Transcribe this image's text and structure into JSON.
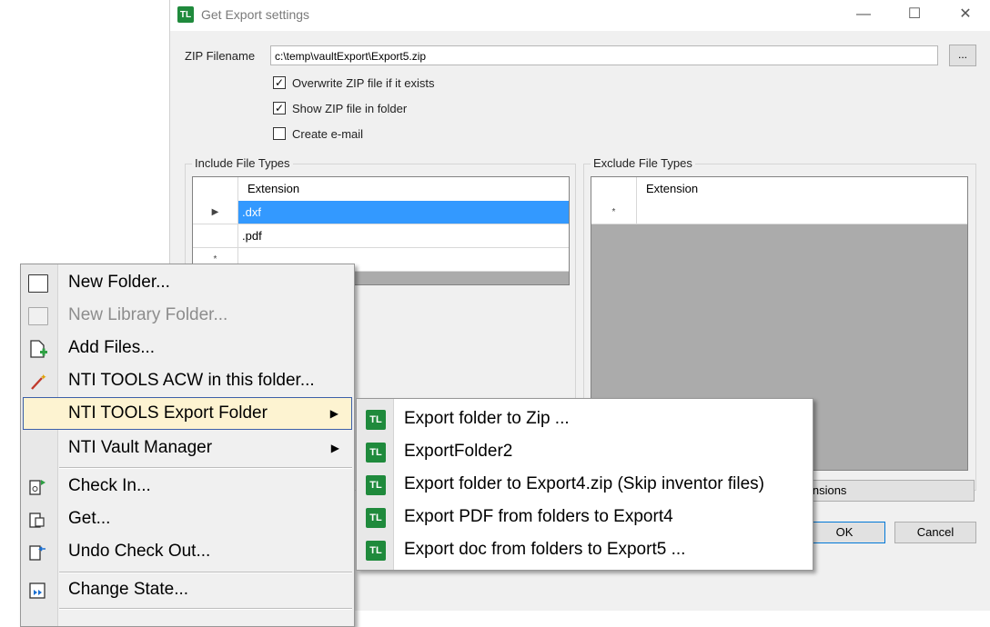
{
  "dialog": {
    "title": "Get Export settings",
    "app_badge": "TL",
    "window_controls": {
      "minimize": "—",
      "maximize": "☐",
      "close": "✕"
    },
    "zip_label": "ZIP Filename",
    "zip_value": "c:\\temp\\vaultExport\\Export5.zip",
    "browse_label": "...",
    "options": [
      {
        "label": "Overwrite ZIP file if it exists",
        "checked": true
      },
      {
        "label": "Show ZIP file in folder",
        "checked": true
      },
      {
        "label": "Create e-mail",
        "checked": false
      }
    ],
    "include": {
      "title": "Include File Types",
      "column": "Extension",
      "rows": [
        ".dxf",
        ".pdf"
      ],
      "current_marker": "▶",
      "new_marker": "*"
    },
    "exclude": {
      "title": "Exclude File Types",
      "column": "Extension",
      "new_marker": "*"
    },
    "extensions_button": "tensions",
    "ok": "OK",
    "cancel": "Cancel"
  },
  "context_menu": {
    "items": [
      {
        "label": "New Folder...",
        "icon": "new-folder-icon",
        "enabled": true
      },
      {
        "label": "New Library Folder...",
        "icon": "library-folder-icon",
        "enabled": false
      },
      {
        "label": "Add Files...",
        "icon": "add-files-icon",
        "enabled": true
      },
      {
        "label": "NTI TOOLS ACW in this folder...",
        "icon": "magic-wand-icon",
        "enabled": true
      },
      {
        "label": "NTI TOOLS Export Folder",
        "icon": "",
        "enabled": true,
        "submenu": true,
        "highlighted": true
      },
      {
        "label": "NTI Vault Manager",
        "icon": "",
        "enabled": true,
        "submenu": true
      },
      {
        "label": "Check In...",
        "icon": "check-in-icon",
        "enabled": true
      },
      {
        "label": "Get...",
        "icon": "get-icon",
        "enabled": true
      },
      {
        "label": "Undo Check Out...",
        "icon": "undo-checkout-icon",
        "enabled": true
      },
      {
        "label": "Change State...",
        "icon": "change-state-icon",
        "enabled": true
      }
    ],
    "submenu_arrow": "▶"
  },
  "submenu": {
    "badge": "TL",
    "items": [
      "Export folder to Zip ...",
      "ExportFolder2",
      "Export folder to Export4.zip (Skip inventor files)",
      "Export PDF from folders to Export4",
      "Export doc from folders to Export5 ..."
    ]
  },
  "colors": {
    "accent": "#3399ff",
    "badge": "#1f8a3c",
    "highlight": "#fdf3d1"
  }
}
